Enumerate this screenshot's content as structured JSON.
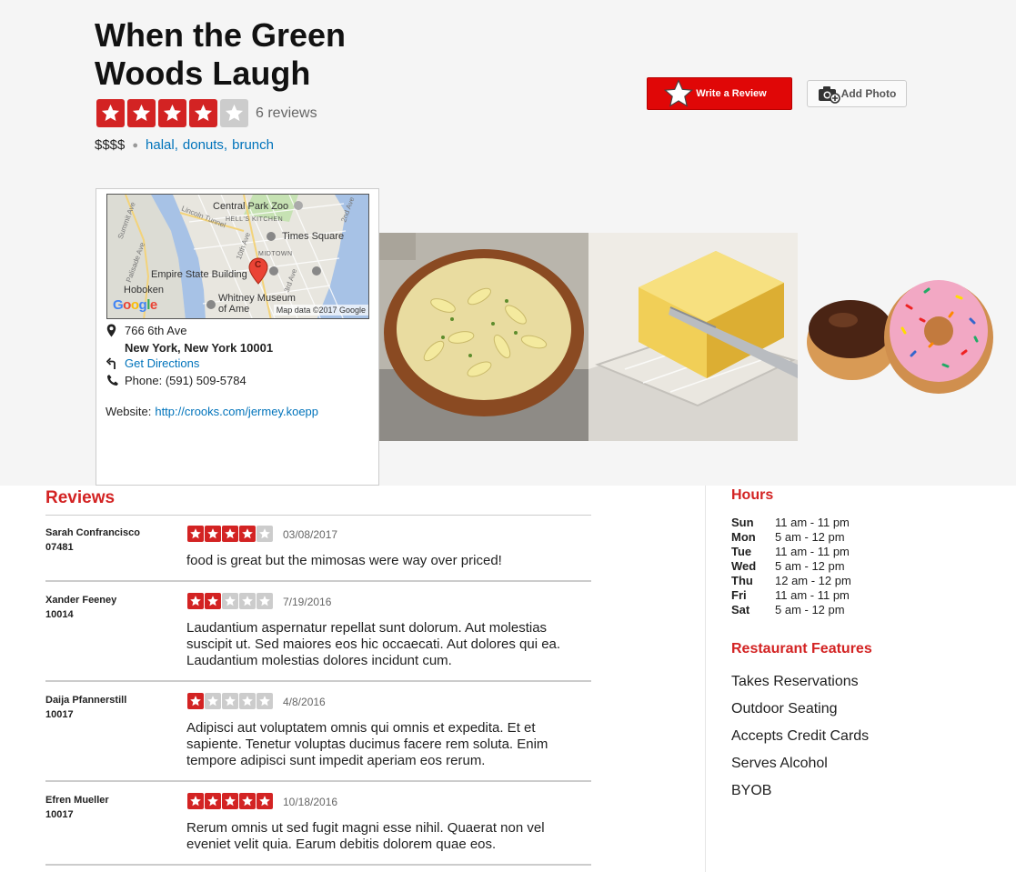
{
  "business": {
    "name": "When the Green Woods Laugh",
    "rating": 4,
    "review_count": "6 reviews",
    "price": "$$$$",
    "categories": [
      "halal,",
      "donuts,",
      "brunch"
    ]
  },
  "actions": {
    "write_review": "Write a Review",
    "add_photo": "Add Photo"
  },
  "location": {
    "street": "766 6th Ave",
    "city": "New York, New York 10001",
    "directions": "Get Directions",
    "phone": "Phone: (591) 509-5784",
    "website_label": "Website:",
    "website_url": "http://crooks.com/jermey.koepp"
  },
  "map": {
    "labels": {
      "central_park_zoo": "Central Park Zoo",
      "hells_kitchen": "HELL'S KITCHEN",
      "lincoln_tunnel": "Lincoln Tunnel",
      "times_square": "Times Square",
      "midtown": "MIDTOWN",
      "empire_state": "Empire State Building",
      "hoboken": "Hoboken",
      "whitney": "Whitney Museum",
      "whitney2": "of Ame",
      "summit_ave": "Summit Ave",
      "palisade_ave": "Palisade Ave",
      "tenth_ave": "10th Ave",
      "second_ave": "2nd Ave",
      "third_ave": "3rd Ave",
      "marker": "C"
    },
    "google": "Google",
    "attribution": "Map data ©2017 Google"
  },
  "photos": [
    "egg-noodle-skillet",
    "butter-stick-dish",
    "donuts"
  ],
  "reviews_title": "Reviews",
  "reviews": [
    {
      "name": "Sarah Confrancisco",
      "zip": "07481",
      "rating": 4,
      "date": "03/08/2017",
      "text": "food is great but the mimosas were way over priced!"
    },
    {
      "name": "Xander Feeney",
      "zip": "10014",
      "rating": 2,
      "date": "7/19/2016",
      "text": "Laudantium aspernatur repellat sunt dolorum. Aut molestias suscipit ut. Sed maiores eos hic occaecati. Aut dolores qui ea. Laudantium molestias dolores incidunt cum."
    },
    {
      "name": "Daija Pfannerstill",
      "zip": "10017",
      "rating": 1,
      "date": "4/8/2016",
      "text": "Adipisci aut voluptatem omnis qui omnis et expedita. Et et sapiente. Tenetur voluptas ducimus facere rem soluta. Enim tempore adipisci sunt impedit aperiam eos rerum."
    },
    {
      "name": "Efren Mueller",
      "zip": "10017",
      "rating": 5,
      "date": "10/18/2016",
      "text": "Rerum omnis ut sed fugit magni esse nihil. Quaerat non vel eveniet velit quia. Earum debitis dolorem quae eos."
    }
  ],
  "hours_title": "Hours",
  "hours": [
    {
      "day": "Sun",
      "time": "11 am - 11 pm"
    },
    {
      "day": "Mon",
      "time": "5 am - 12 pm"
    },
    {
      "day": "Tue",
      "time": "11 am - 11 pm"
    },
    {
      "day": "Wed",
      "time": "5 am - 12 pm"
    },
    {
      "day": "Thu",
      "time": "12 am - 12 pm"
    },
    {
      "day": "Fri",
      "time": "11 am - 11 pm"
    },
    {
      "day": "Sat",
      "time": "5 am - 12 pm"
    }
  ],
  "features_title": "Restaurant Features",
  "features": [
    "Takes Reservations",
    "Outdoor Seating",
    "Accepts Credit Cards",
    "Serves Alcohol",
    "BYOB"
  ],
  "colors": {
    "brand_red": "#d32323",
    "button_red": "#e00707",
    "link_blue": "#0073bb"
  }
}
